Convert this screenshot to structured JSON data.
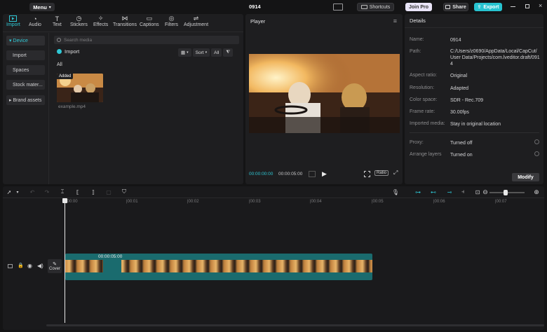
{
  "titlebar": {
    "menu_label": "Menu",
    "project_title": "0914",
    "shortcuts_label": "Shortcuts",
    "joinpro_label": "Join Pro",
    "share_label": "Share",
    "export_label": "Export"
  },
  "media_tabs": [
    {
      "label": "Import",
      "icon": "import-icon",
      "active": true
    },
    {
      "label": "Audio",
      "icon": "audio-icon"
    },
    {
      "label": "Text",
      "icon": "text-icon"
    },
    {
      "label": "Stickers",
      "icon": "stickers-icon"
    },
    {
      "label": "Effects",
      "icon": "effects-icon"
    },
    {
      "label": "Transitions",
      "icon": "transitions-icon"
    },
    {
      "label": "Captions",
      "icon": "captions-icon"
    },
    {
      "label": "Filters",
      "icon": "filters-icon"
    },
    {
      "label": "Adjustment",
      "icon": "adjustment-icon"
    }
  ],
  "media_sidebar": [
    {
      "label": "Device",
      "active": true,
      "prefix": "▾"
    },
    {
      "label": "Import"
    },
    {
      "label": "Spaces"
    },
    {
      "label": "Stock mater..."
    },
    {
      "label": "Brand assets",
      "prefix": "▸"
    }
  ],
  "media": {
    "search_placeholder": "Search media",
    "import_label": "Import",
    "sort_label": "Sort",
    "all_filter_label": "All",
    "section_label": "All",
    "clip_badge": "Added",
    "clip_name": "example.mp4"
  },
  "player": {
    "title": "Player",
    "current_time": "00:00:00:00",
    "total_time": "00:00:05:00",
    "ratio_label": "Ratio"
  },
  "details": {
    "title": "Details",
    "rows": [
      {
        "label": "Name:",
        "value": "0914"
      },
      {
        "label": "Path:",
        "value": "C:/Users/z0690/AppData/Local/CapCut/User Data/Projects/com.lveditor.draft/0914"
      },
      {
        "label": "Aspect ratio:",
        "value": "Original"
      },
      {
        "label": "Resolution:",
        "value": "Adapted"
      },
      {
        "label": "Color space:",
        "value": "SDR - Rec.709"
      },
      {
        "label": "Frame rate:",
        "value": "30.00fps"
      },
      {
        "label": "Imported media:",
        "value": "Stay in original location"
      },
      {
        "label": "Proxy:",
        "value": "Turned off"
      },
      {
        "label": "Arrange layers",
        "value": "Turned on"
      }
    ],
    "modify_label": "Modify"
  },
  "timeline": {
    "ruler_ticks": [
      "|00:00",
      "|00:01",
      "|00:02",
      "|00:03",
      "|00:04",
      "|00:05",
      "|00:06",
      "|00:07"
    ],
    "clip_duration": "00:00:05:00",
    "cover_label": "Cover"
  }
}
